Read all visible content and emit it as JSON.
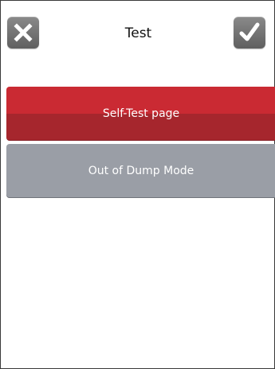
{
  "header": {
    "title": "Test",
    "cancel_icon": "close-icon",
    "confirm_icon": "checkmark-icon"
  },
  "menu": {
    "items": [
      {
        "label": "Self-Test page",
        "selected": true
      },
      {
        "label": "Out of Dump Mode",
        "selected": false
      }
    ]
  },
  "colors": {
    "selected": "#ca2a33",
    "normal": "#9a9ea6",
    "icon_button": "#6f6f6f"
  }
}
